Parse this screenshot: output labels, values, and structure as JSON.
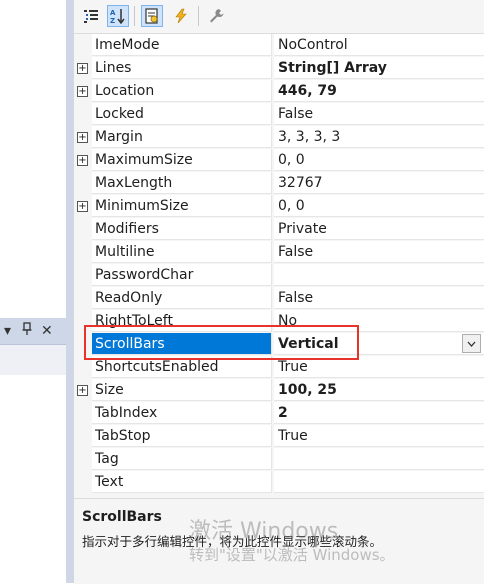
{
  "left_panel": {
    "dropdown_glyph": "▾",
    "pin_glyph": "⚐",
    "close_glyph": "✕"
  },
  "toolbar": {
    "buttons": [
      {
        "name": "categorized-view-icon",
        "active": false
      },
      {
        "name": "alphabetical-sort-icon",
        "active": true
      },
      {
        "name": "properties-icon",
        "active": true
      },
      {
        "name": "events-lightning-icon",
        "active": false
      },
      {
        "name": "property-pages-wrench-icon",
        "active": false
      }
    ]
  },
  "properties": [
    {
      "name": "ImeMode",
      "value": "NoControl",
      "expandable": false,
      "bold": false
    },
    {
      "name": "Lines",
      "value": "String[] Array",
      "expandable": true,
      "bold": true
    },
    {
      "name": "Location",
      "value": "446, 79",
      "expandable": true,
      "bold": true
    },
    {
      "name": "Locked",
      "value": "False",
      "expandable": false,
      "bold": false
    },
    {
      "name": "Margin",
      "value": "3, 3, 3, 3",
      "expandable": true,
      "bold": false
    },
    {
      "name": "MaximumSize",
      "value": "0, 0",
      "expandable": true,
      "bold": false
    },
    {
      "name": "MaxLength",
      "value": "32767",
      "expandable": false,
      "bold": false
    },
    {
      "name": "MinimumSize",
      "value": "0, 0",
      "expandable": true,
      "bold": false
    },
    {
      "name": "Modifiers",
      "value": "Private",
      "expandable": false,
      "bold": false
    },
    {
      "name": "Multiline",
      "value": "False",
      "expandable": false,
      "bold": false
    },
    {
      "name": "PasswordChar",
      "value": "",
      "expandable": false,
      "bold": false
    },
    {
      "name": "ReadOnly",
      "value": "False",
      "expandable": false,
      "bold": false
    },
    {
      "name": "RightToLeft",
      "value": "No",
      "expandable": false,
      "bold": false
    },
    {
      "name": "ScrollBars",
      "value": "Vertical",
      "expandable": false,
      "bold": true,
      "selected": true
    },
    {
      "name": "ShortcutsEnabled",
      "value": "True",
      "expandable": false,
      "bold": false
    },
    {
      "name": "Size",
      "value": "100, 25",
      "expandable": true,
      "bold": true
    },
    {
      "name": "TabIndex",
      "value": "2",
      "expandable": false,
      "bold": true
    },
    {
      "name": "TabStop",
      "value": "True",
      "expandable": false,
      "bold": false
    },
    {
      "name": "Tag",
      "value": "",
      "expandable": false,
      "bold": false
    },
    {
      "name": "Text",
      "value": "",
      "expandable": false,
      "bold": false
    }
  ],
  "description": {
    "title": "ScrollBars",
    "text": "指示对于多行编辑控件，将为此控件显示哪些滚动条。"
  },
  "watermark": {
    "line1": "激活 Windows",
    "line2": "转到\"设置\"以激活 Windows。"
  },
  "colors": {
    "selection": "#0078d7",
    "highlight_border": "#e8322c",
    "panel_header": "#cdd7e8"
  }
}
